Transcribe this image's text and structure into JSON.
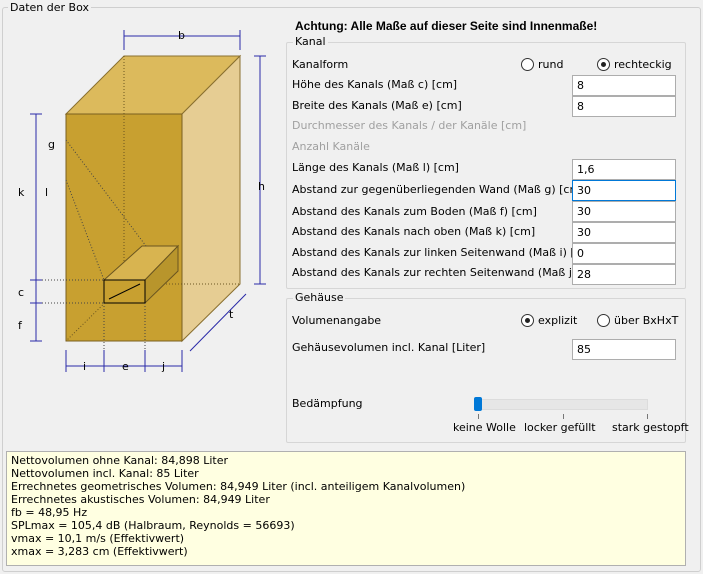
{
  "frame_title": "Daten der Box",
  "warning": "Achtung: Alle Maße auf dieser Seite sind Innenmaße!",
  "diagram": {
    "labels": {
      "b": "b",
      "h": "h",
      "t": "t",
      "g": "g",
      "k": "k",
      "l": "l",
      "c": "c",
      "f": "f",
      "i": "i",
      "e": "e",
      "j": "j"
    }
  },
  "kanal": {
    "group_title": "Kanal",
    "kanalform_label": "Kanalform",
    "option_rund": "rund",
    "option_rechteckig": "rechteckig",
    "selected": "rechteckig",
    "hoehe_label": "Höhe des Kanals (Maß c) [cm]",
    "hoehe_value": "8",
    "breite_label": "Breite des Kanals (Maß e) [cm]",
    "breite_value": "8",
    "durchmesser_label": "Durchmesser des Kanals / der Kanäle [cm]",
    "anzahl_label": "Anzahl Kanäle",
    "laenge_label": "Länge des Kanals (Maß l) [cm]",
    "laenge_value": "1,6",
    "abstand_wand_label": "Abstand zur gegenüberliegenden Wand (Maß g) [cm]",
    "abstand_wand_value": "30",
    "abstand_boden_label": "Abstand des Kanals zum Boden (Maß f) [cm]",
    "abstand_boden_value": "30",
    "abstand_oben_label": "Abstand des Kanals nach oben (Maß k) [cm]",
    "abstand_oben_value": "30",
    "abstand_links_label": "Abstand des Kanals zur linken Seitenwand (Maß i) [cm]",
    "abstand_links_value": "0",
    "abstand_rechts_label": "Abstand des Kanals zur rechten Seitenwand (Maß j) [cm]",
    "abstand_rechts_value": "28"
  },
  "gehaeuse": {
    "group_title": "Gehäuse",
    "volumenangabe_label": "Volumenangabe",
    "option_explizit": "explizit",
    "option_bxhxt": "über BxHxT",
    "selected": "explizit",
    "volumen_label": "Gehäusevolumen incl. Kanal [Liter]",
    "volumen_value": "85"
  },
  "daempfung": {
    "label": "Bedämpfung",
    "position": 0,
    "ticks": [
      "keine Wolle",
      "locker gefüllt",
      "stark gestopft"
    ]
  },
  "results": [
    "Nettovolumen ohne Kanal: 84,898 Liter",
    "Nettovolumen incl. Kanal: 85 Liter",
    "Errechnetes geometrisches Volumen: 84,949 Liter (incl. anteiligem Kanalvolumen)",
    "Errechnetes akustisches Volumen: 84,949 Liter",
    "fb = 48,95 Hz",
    "SPLmax = 105,4 dB (Halbraum, Reynolds = 56693)",
    "vmax = 10,1 m/s (Effektivwert)",
    "xmax = 3,283 cm (Effektivwert)"
  ],
  "colors": {
    "box_front": "#c8a030",
    "box_top": "#dcba5c",
    "box_side": "#e6cd93",
    "dimension_line": "#2a2aa8",
    "results_bg": "#ffffe1",
    "slider_accent": "#0078d7"
  }
}
